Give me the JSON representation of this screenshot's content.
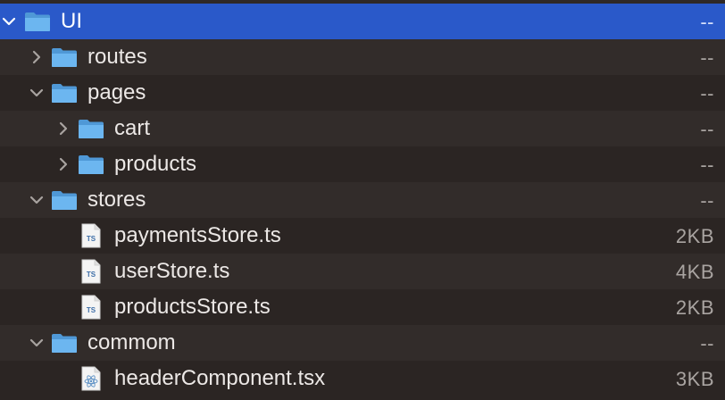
{
  "rows": [
    {
      "name": "UI",
      "size": "--",
      "kind": "folder",
      "expanded": true,
      "selected": true,
      "depth": 0
    },
    {
      "name": "routes",
      "size": "--",
      "kind": "folder",
      "expanded": false,
      "depth": 1
    },
    {
      "name": "pages",
      "size": "--",
      "kind": "folder",
      "expanded": true,
      "depth": 1
    },
    {
      "name": "cart",
      "size": "--",
      "kind": "folder",
      "expanded": false,
      "depth": 2
    },
    {
      "name": "products",
      "size": "--",
      "kind": "folder",
      "expanded": false,
      "depth": 2
    },
    {
      "name": "stores",
      "size": "--",
      "kind": "folder",
      "expanded": true,
      "depth": 1
    },
    {
      "name": "paymentsStore.ts",
      "size": "2KB",
      "kind": "ts-file",
      "depth": 2
    },
    {
      "name": "userStore.ts",
      "size": "4KB",
      "kind": "ts-file",
      "depth": 2
    },
    {
      "name": "productsStore.ts",
      "size": "2KB",
      "kind": "ts-file",
      "depth": 2
    },
    {
      "name": "commom",
      "size": "--",
      "kind": "folder",
      "expanded": true,
      "depth": 1
    },
    {
      "name": "headerComponent.tsx",
      "size": "3KB",
      "kind": "tsx-file",
      "depth": 2
    }
  ],
  "icons": {
    "folder": "folder-icon",
    "ts-file": "typescript-file-icon",
    "tsx-file": "react-file-icon",
    "expanded": "chevron-down-icon",
    "collapsed": "chevron-right-icon"
  },
  "file_badge": "TS",
  "colors": {
    "selection": "#2a59c9",
    "folder": "#5aa8e8",
    "row_alt": "#322c2a",
    "background": "#2b2523"
  }
}
